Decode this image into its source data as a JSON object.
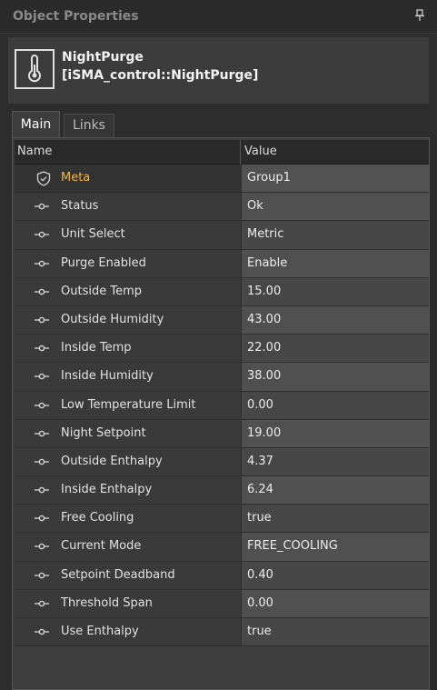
{
  "panel": {
    "title": "Object Properties"
  },
  "object": {
    "name": "NightPurge",
    "type": "[iSMA_control::NightPurge]"
  },
  "tabs": [
    {
      "label": "Main"
    },
    {
      "label": "Links"
    }
  ],
  "grid": {
    "columns": {
      "name": "Name",
      "value": "Value"
    },
    "rows": [
      {
        "label": "Meta",
        "value": "Group1"
      },
      {
        "label": "Status",
        "value": "Ok"
      },
      {
        "label": "Unit Select",
        "value": "Metric"
      },
      {
        "label": "Purge Enabled",
        "value": "Enable"
      },
      {
        "label": "Outside Temp",
        "value": "15.00"
      },
      {
        "label": "Outside Humidity",
        "value": "43.00"
      },
      {
        "label": "Inside Temp",
        "value": "22.00"
      },
      {
        "label": "Inside Humidity",
        "value": "38.00"
      },
      {
        "label": "Low Temperature Limit",
        "value": "0.00"
      },
      {
        "label": "Night Setpoint",
        "value": "19.00"
      },
      {
        "label": "Outside Enthalpy",
        "value": "4.37"
      },
      {
        "label": "Inside Enthalpy",
        "value": "6.24"
      },
      {
        "label": "Free Cooling",
        "value": "true"
      },
      {
        "label": "Current Mode",
        "value": "FREE_COOLING"
      },
      {
        "label": "Setpoint Deadband",
        "value": "0.40"
      },
      {
        "label": "Threshold Span",
        "value": "0.00"
      },
      {
        "label": "Use Enthalpy",
        "value": "true"
      }
    ]
  },
  "icons": {
    "pin": "pin-icon",
    "object": "thermometer-icon",
    "meta": "shield-check-icon",
    "slot": "slot-connector-icon"
  },
  "colors": {
    "meta_label": "#f0b84a",
    "panel_bg": "#2d2d2d"
  }
}
